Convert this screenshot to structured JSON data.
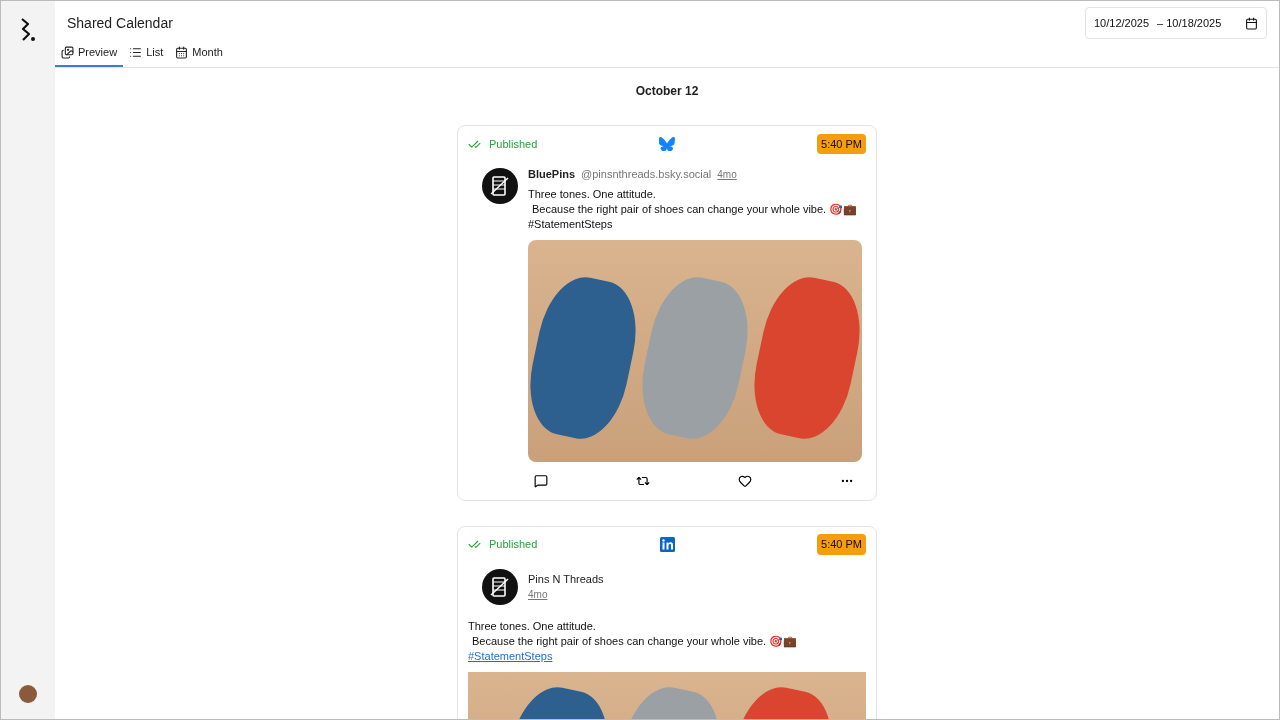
{
  "header": {
    "title": "Shared Calendar",
    "date_range": {
      "start": "10/12/2025",
      "end": "– 10/18/2025"
    }
  },
  "tabs": [
    {
      "label": "Preview",
      "kind": "preview",
      "selected": true
    },
    {
      "label": "List",
      "kind": "list",
      "selected": false
    },
    {
      "label": "Month",
      "kind": "month",
      "selected": false
    }
  ],
  "day": {
    "heading": "October 12"
  },
  "posts": [
    {
      "kind": "bluesky",
      "status": "Published",
      "time": "5:40 PM",
      "author": "BluePins",
      "handle": "@pinsnthreads.bsky.social",
      "age": "4mo",
      "lines": [
        "Three tones. One attitude.",
        "Because the right pair of shoes can change your whole vibe. 🎯💼"
      ],
      "hashtag": "#StatementSteps"
    },
    {
      "kind": "linkedin",
      "status": "Published",
      "time": "5:40 PM",
      "author": "Pins N Threads",
      "age": "4mo",
      "lines": [
        "Three tones. One attitude.",
        "Because the right pair of shoes can change your whole vibe. 🎯💼"
      ],
      "hashtag": "#StatementSteps"
    }
  ]
}
